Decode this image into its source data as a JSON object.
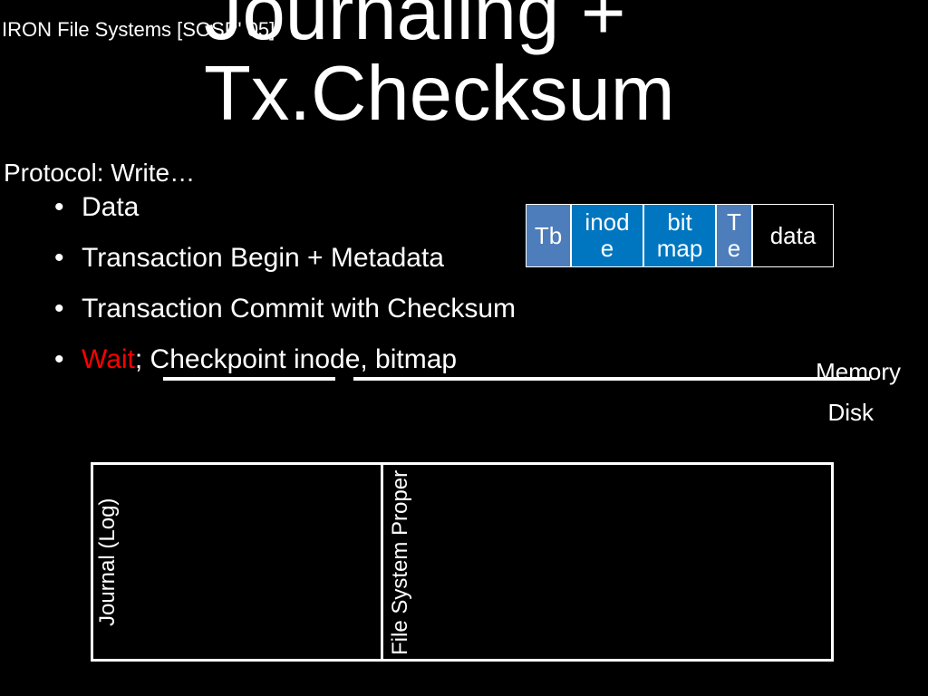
{
  "header_ref": "IRON File Systems [SOSP' 05]",
  "title_line1": "Journaling +",
  "title_line2": "Tx.Checksum",
  "protocol_label": "Protocol: Write…",
  "bullets": {
    "b1": "Data",
    "b2": "Transaction Begin + Metadata",
    "b3": "Transaction Commit with Checksum",
    "b4_wait": "Wait",
    "b4_rest": "; Checkpoint inode, bitmap"
  },
  "blocks": {
    "tb": "Tb",
    "inode": "inod\ne",
    "bitmap": "bit\nmap",
    "te": "T\ne",
    "data": "data"
  },
  "memory_label": "Memory",
  "disk_label": "Disk",
  "journal_label": "Journal (Log)",
  "fsp_label": "File System Proper"
}
